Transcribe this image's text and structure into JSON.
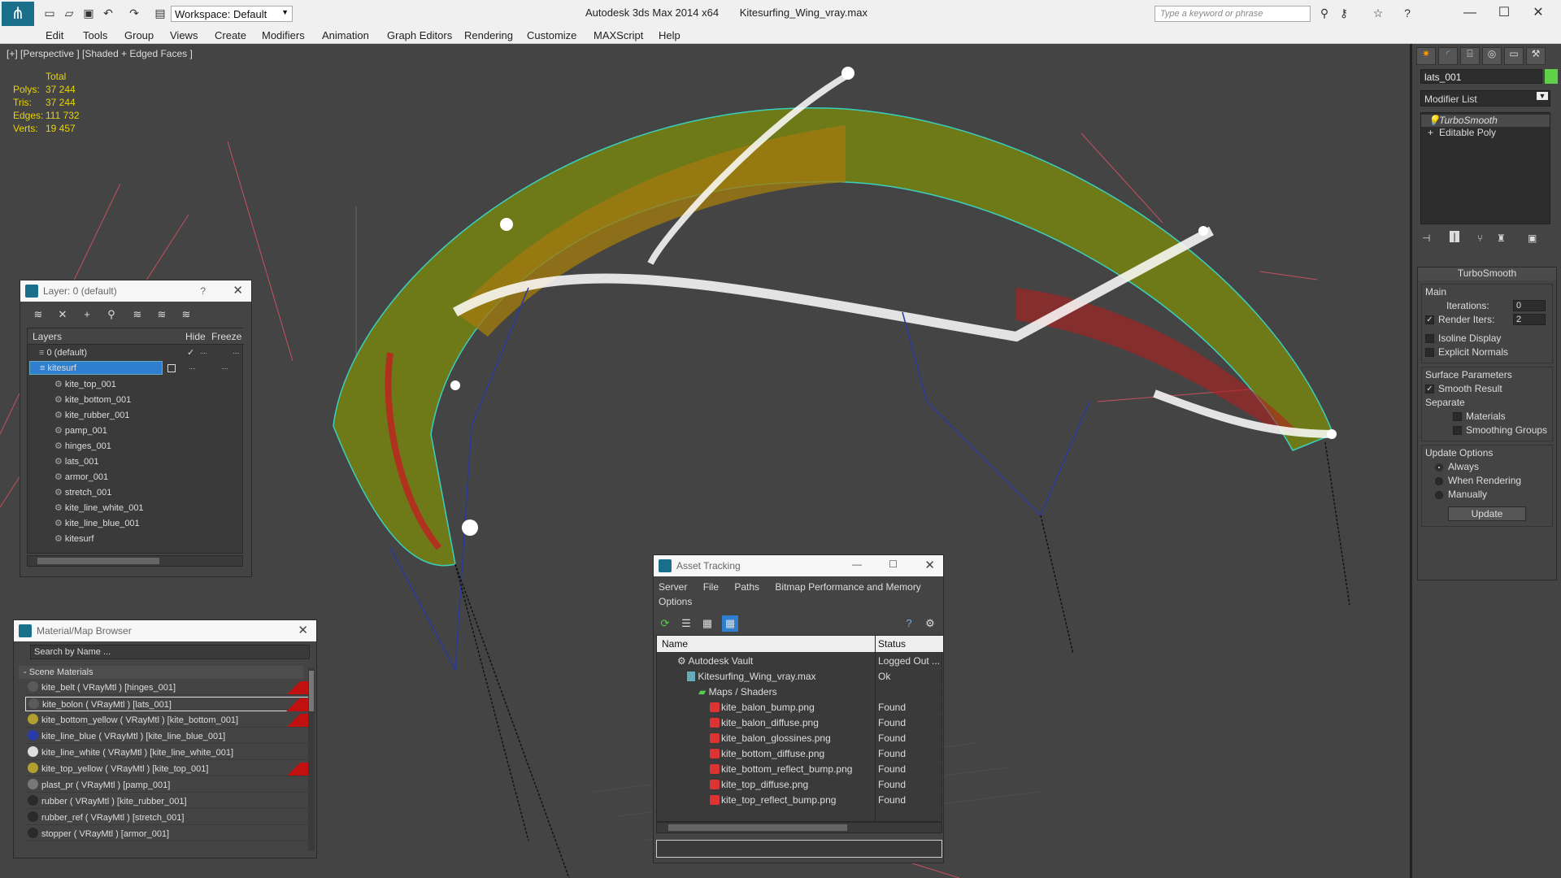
{
  "app": {
    "title": "Autodesk 3ds Max  2014 x64",
    "file": "Kitesurfing_Wing_vray.max",
    "workspace": "Workspace: Default",
    "search_placeholder": "Type a keyword or phrase"
  },
  "menu": [
    "Edit",
    "Tools",
    "Group",
    "Views",
    "Create",
    "Modifiers",
    "Animation",
    "Graph Editors",
    "Rendering",
    "Customize",
    "MAXScript",
    "Help"
  ],
  "viewport": {
    "label": "[+] [Perspective ] [Shaded + Edged Faces ]",
    "stats": {
      "header": "Total",
      "rows": [
        {
          "label": "Polys:",
          "value": "37 244"
        },
        {
          "label": "Tris:",
          "value": "37 244"
        },
        {
          "label": "Edges:",
          "value": "111 732"
        },
        {
          "label": "Verts:",
          "value": "19 457"
        }
      ]
    }
  },
  "command_panel": {
    "object_name": "lats_001",
    "modifier_list": "Modifier List",
    "stack": [
      "TurboSmooth",
      "Editable Poly"
    ],
    "rollout_title": "TurboSmooth",
    "main_group": "Main",
    "iterations_label": "Iterations:",
    "iterations_value": "0",
    "render_iters_label": "Render Iters:",
    "render_iters_value": "2",
    "isoline": "Isoline Display",
    "explicit_normals": "Explicit Normals",
    "surface_group": "Surface Parameters",
    "smooth_result": "Smooth Result",
    "separate": "Separate",
    "materials": "Materials",
    "smoothing_groups": "Smoothing Groups",
    "update_group": "Update Options",
    "always": "Always",
    "when_rendering": "When Rendering",
    "manually": "Manually",
    "update_button": "Update"
  },
  "layer_dialog": {
    "title": "Layer: 0 (default)",
    "help": "?",
    "col_layers": "Layers",
    "col_hide": "Hide",
    "col_freeze": "Freeze",
    "layers": [
      "0 (default)",
      "kitesurf"
    ],
    "objects": [
      "kite_top_001",
      "kite_bottom_001",
      "kite_rubber_001",
      "pamp_001",
      "hinges_001",
      "lats_001",
      "armor_001",
      "stretch_001",
      "kite_line_white_001",
      "kite_line_blue_001",
      "kitesurf"
    ]
  },
  "material_browser": {
    "title": "Material/Map Browser",
    "search_placeholder": "Search by Name ...",
    "section": "- Scene Materials",
    "materials": [
      {
        "text": "kite_belt  ( VRayMtl ) [hinges_001]",
        "color": "#5a5a5a",
        "flag": true
      },
      {
        "text": "kite_bolon  ( VRayMtl ) [lats_001]",
        "color": "#5a5a5a",
        "flag": true
      },
      {
        "text": "kite_bottom_yellow  ( VRayMtl ) [kite_bottom_001]",
        "color": "#b0a030",
        "flag": true
      },
      {
        "text": "kite_line_blue  ( VRayMtl ) [kite_line_blue_001]",
        "color": "#2a3aa8",
        "flag": false
      },
      {
        "text": "kite_line_white  ( VRayMtl ) [kite_line_white_001]",
        "color": "#dddddd",
        "flag": false
      },
      {
        "text": "kite_top_yellow  ( VRayMtl ) [kite_top_001]",
        "color": "#b0a030",
        "flag": true
      },
      {
        "text": "plast_pr  ( VRayMtl ) [pamp_001]",
        "color": "#777777",
        "flag": false
      },
      {
        "text": "rubber  ( VRayMtl ) [kite_rubber_001]",
        "color": "#2a2a2a",
        "flag": false
      },
      {
        "text": "rubber_ref  ( VRayMtl ) [stretch_001]",
        "color": "#2a2a2a",
        "flag": false
      },
      {
        "text": "stopper  ( VRayMtl ) [armor_001]",
        "color": "#2a2a2a",
        "flag": false
      }
    ]
  },
  "asset_tracking": {
    "title": "Asset Tracking",
    "menu": [
      "Server",
      "File",
      "Paths",
      "Bitmap Performance and Memory"
    ],
    "menu2": "Options",
    "col_name": "Name",
    "col_status": "Status",
    "rows": [
      {
        "name": "Autodesk Vault",
        "status": "Logged Out ...",
        "indent": 0
      },
      {
        "name": "Kitesurfing_Wing_vray.max",
        "status": "Ok",
        "indent": 1
      },
      {
        "name": "Maps / Shaders",
        "status": "",
        "indent": 2
      },
      {
        "name": "kite_balon_bump.png",
        "status": "Found",
        "indent": 3
      },
      {
        "name": "kite_balon_diffuse.png",
        "status": "Found",
        "indent": 3
      },
      {
        "name": "kite_balon_glossines.png",
        "status": "Found",
        "indent": 3
      },
      {
        "name": "kite_bottom_diffuse.png",
        "status": "Found",
        "indent": 3
      },
      {
        "name": "kite_bottom_reflect_bump.png",
        "status": "Found",
        "indent": 3
      },
      {
        "name": "kite_top_diffuse.png",
        "status": "Found",
        "indent": 3
      },
      {
        "name": "kite_top_reflect_bump.png",
        "status": "Found",
        "indent": 3
      }
    ]
  }
}
